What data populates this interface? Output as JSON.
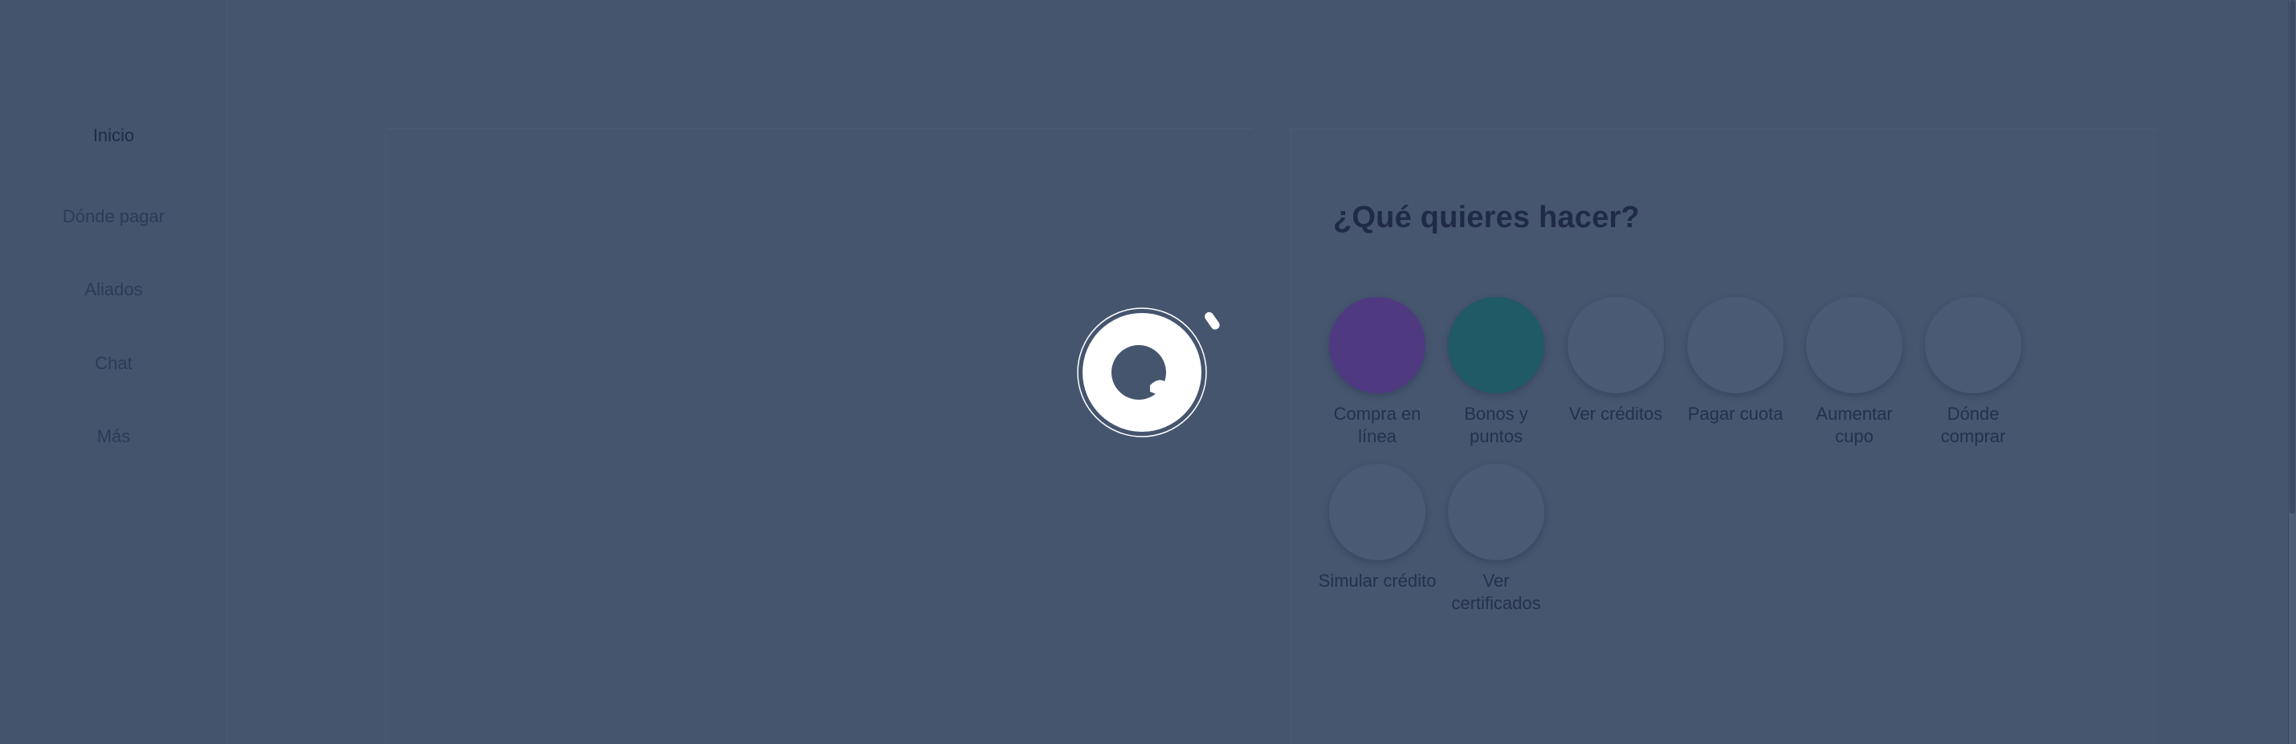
{
  "sidebar": {
    "items": [
      {
        "label": "Inicio"
      },
      {
        "label": "Dónde pagar"
      },
      {
        "label": "Aliados"
      },
      {
        "label": "Chat"
      },
      {
        "label": "Más"
      }
    ]
  },
  "main": {
    "title": "¿Qué quieres hacer?",
    "actions": [
      {
        "label": "Compra en línea",
        "color": "#4f3a82"
      },
      {
        "label": "Bonos y puntos",
        "color": "#1f5a66"
      },
      {
        "label": "Ver créditos",
        "color": "#4a5a74"
      },
      {
        "label": "Pagar cuota",
        "color": "#4a5a74"
      },
      {
        "label": "Aumentar cupo",
        "color": "#4a5a74"
      },
      {
        "label": "Dónde comprar",
        "color": "#4a5a74"
      },
      {
        "label": "Simular crédito",
        "color": "#4a5a74"
      },
      {
        "label": "Ver certificados",
        "color": "#4a5a74"
      }
    ]
  },
  "loader": {
    "icon": "loading-spinner-icon"
  },
  "colors": {
    "overlay": "#45556e",
    "title": "#1f2b46",
    "text": "#24314d"
  }
}
